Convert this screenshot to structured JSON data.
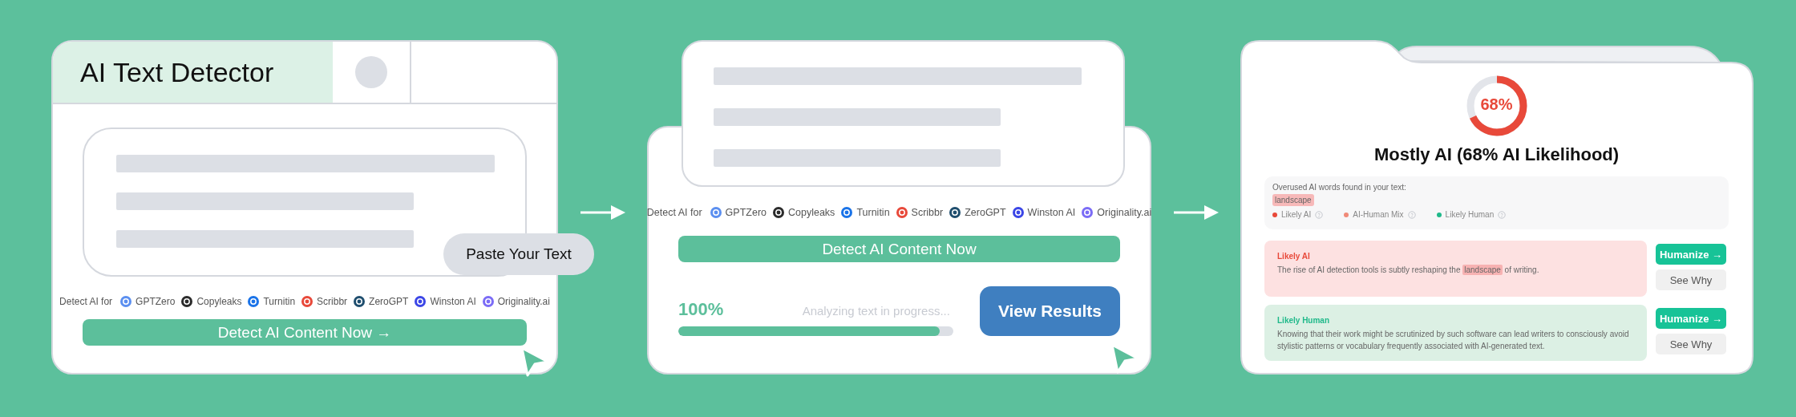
{
  "input_panel": {
    "title": "AI Text Detector",
    "paste_button": "Paste Your Text",
    "detect_label": "Detect AI for",
    "tools": [
      {
        "name": "GPTZero",
        "color": "#5b8ff0"
      },
      {
        "name": "Copyleaks",
        "color": "#2b2b2b"
      },
      {
        "name": "Turnitin",
        "color": "#1a73e8"
      },
      {
        "name": "Scribbr",
        "color": "#e8493a"
      },
      {
        "name": "ZeroGPT",
        "color": "#1f4e6e"
      },
      {
        "name": "Winston AI",
        "color": "#3b46e6"
      },
      {
        "name": "Originality.ai",
        "color": "#7b6cf6"
      }
    ],
    "detect_button": "Detect AI Content Now →"
  },
  "progress_panel": {
    "detect_label": "Detect AI for",
    "tools": [
      {
        "name": "GPTZero",
        "color": "#5b8ff0"
      },
      {
        "name": "Copyleaks",
        "color": "#2b2b2b"
      },
      {
        "name": "Turnitin",
        "color": "#1a73e8"
      },
      {
        "name": "Scribbr",
        "color": "#e8493a"
      },
      {
        "name": "ZeroGPT",
        "color": "#1f4e6e"
      },
      {
        "name": "Winston AI",
        "color": "#3b46e6"
      },
      {
        "name": "Originality.ai",
        "color": "#7b6cf6"
      }
    ],
    "detect_button": "Detect AI Content Now",
    "percent": "100%",
    "status": "Analyzing text in progress...",
    "level": 0.95,
    "view_button": "View Results"
  },
  "result_panel": {
    "score": "68%",
    "level": 0.68,
    "verdict": "Mostly AI (68% AI Likelihood)",
    "overused_label": "Overused AI words found in your text:",
    "overused_words": [
      "landscape"
    ],
    "legend": [
      {
        "label": "Likely AI",
        "color": "#e8493a"
      },
      {
        "label": "AI-Human Mix",
        "color": "#f08a78"
      },
      {
        "label": "Likely Human",
        "color": "#1fb98a"
      }
    ],
    "segments": [
      {
        "kind": "ai",
        "label": "Likely AI",
        "parts": [
          {
            "text": "The rise of AI detection tools is subtly reshaping the "
          },
          {
            "text": "landscape",
            "highlight": true
          },
          {
            "text": " of writing."
          }
        ],
        "humanize": "Humanize →",
        "why": "See Why"
      },
      {
        "kind": "human",
        "label": "Likely Human",
        "parts": [
          {
            "text": "Knowing that their work might be scrutinized by such software can lead writers to consciously avoid stylistic patterns or vocabulary frequently associated with AI-generated text."
          }
        ],
        "humanize": "Humanize →",
        "why": "See Why"
      }
    ]
  }
}
